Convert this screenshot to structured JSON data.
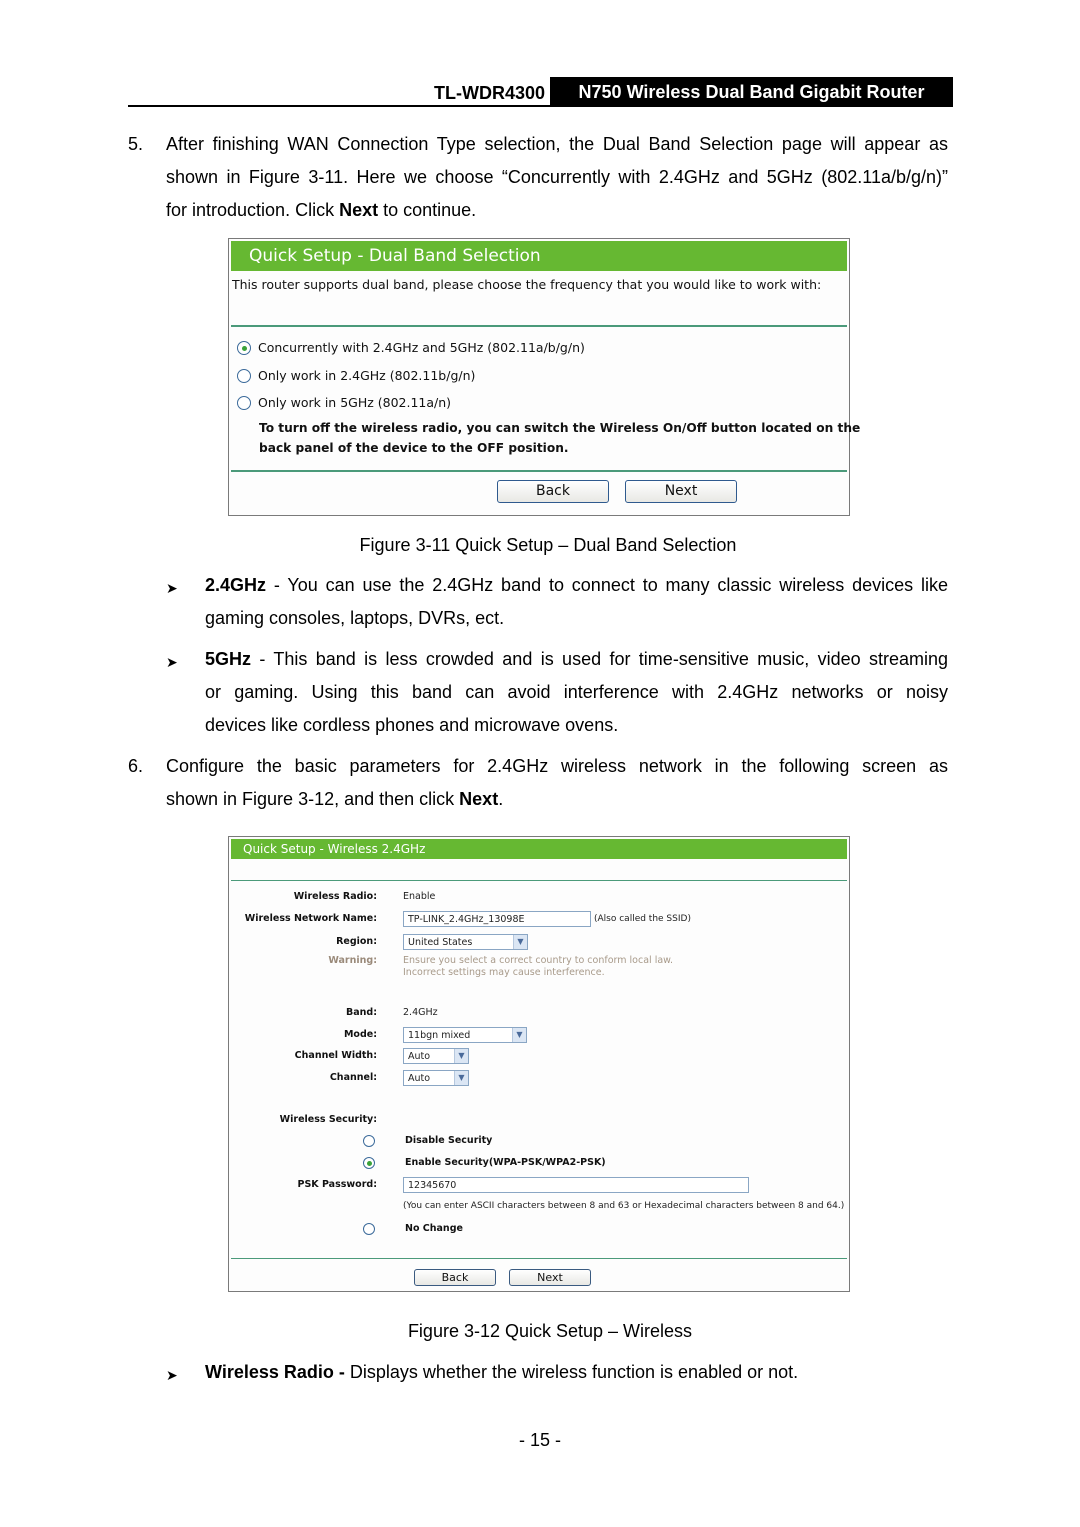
{
  "header": {
    "model": "TL-WDR4300",
    "product": "N750 Wireless Dual Band Gigabit Router"
  },
  "step5": {
    "number": "5.",
    "line1": "After finishing WAN Connection Type selection, the Dual Band Selection page will appear as",
    "line2": "shown in Figure 3-11. Here we choose “Concurrently with 2.4GHz and 5GHz (802.11a/b/g/n)”",
    "line3_pre": "for introduction. Click ",
    "line3_bold": "Next",
    "line3_post": " to continue."
  },
  "figure1": {
    "title": "Quick Setup - Dual Band Selection",
    "intro": "This router supports dual band, please choose the frequency that you would like to work with:",
    "options": [
      {
        "label": "Concurrently with 2.4GHz and 5GHz (802.11a/b/g/n)",
        "selected": true
      },
      {
        "label": "Only work in 2.4GHz (802.11b/g/n)",
        "selected": false
      },
      {
        "label": "Only work in 5GHz (802.11a/n)",
        "selected": false
      }
    ],
    "note_line1": "To turn off the wireless radio, you can switch the Wireless On/Off button located on the",
    "note_line2": "back panel of the device to the OFF position.",
    "back_label": "Back",
    "next_label": "Next",
    "caption": "Figure 3-11 Quick Setup – Dual Band Selection"
  },
  "bullets1": [
    {
      "bold": "2.4GHz",
      "line1": " - You can use the 2.4GHz band to connect to many classic wireless devices like",
      "line2": "gaming consoles, laptops, DVRs, ect."
    },
    {
      "bold": "5GHz",
      "line1": " - This band is less crowded and is used for time-sensitive music, video streaming",
      "line2": "or gaming. Using this band can avoid interference with 2.4GHz networks or noisy",
      "line3": "devices like cordless phones and microwave ovens."
    }
  ],
  "step6": {
    "number": "6.",
    "line1": "Configure the basic parameters for 2.4GHz wireless network in the following screen as",
    "line2_pre": "shown in Figure 3-12, and then click ",
    "line2_bold": "Next",
    "line2_post": "."
  },
  "figure2": {
    "title": "Quick Setup - Wireless 2.4GHz",
    "wireless_radio_label": "Wireless Radio:",
    "wireless_radio_value": "Enable",
    "ssid_label": "Wireless Network Name:",
    "ssid_value": "TP-LINK_2.4GHz_13098E",
    "ssid_note": "(Also called the SSID)",
    "region_label": "Region:",
    "region_value": "United States",
    "warning_label": "Warning:",
    "warning_line1": "Ensure you select a correct country to conform local law.",
    "warning_line2": "Incorrect settings may cause interference.",
    "band_label": "Band:",
    "band_value": "2.4GHz",
    "mode_label": "Mode:",
    "mode_value": "11bgn mixed",
    "channel_width_label": "Channel Width:",
    "channel_width_value": "Auto",
    "channel_label": "Channel:",
    "channel_value": "Auto",
    "security_label": "Wireless Security:",
    "security_options": [
      {
        "label": "Disable Security",
        "selected": false
      },
      {
        "label": "Enable Security(WPA-PSK/WPA2-PSK)",
        "selected": true
      },
      {
        "label": "No Change",
        "selected": false
      }
    ],
    "psk_label": "PSK Password:",
    "psk_value": "12345670",
    "psk_note": "(You can enter ASCII characters between 8 and 63 or Hexadecimal characters between 8 and 64.)",
    "back_label": "Back",
    "next_label": "Next",
    "caption": "Figure 3-12 Quick Setup – Wireless"
  },
  "bullets2": [
    {
      "bold": "Wireless Radio -",
      "text": " Displays whether the wireless function is enabled or not."
    }
  ],
  "footer": {
    "page_number": "- 15 -"
  },
  "colors": {
    "title_bar_green": "#66b832",
    "separator_green": "#4b9a7a",
    "radio_selected": "#3aa23a"
  }
}
